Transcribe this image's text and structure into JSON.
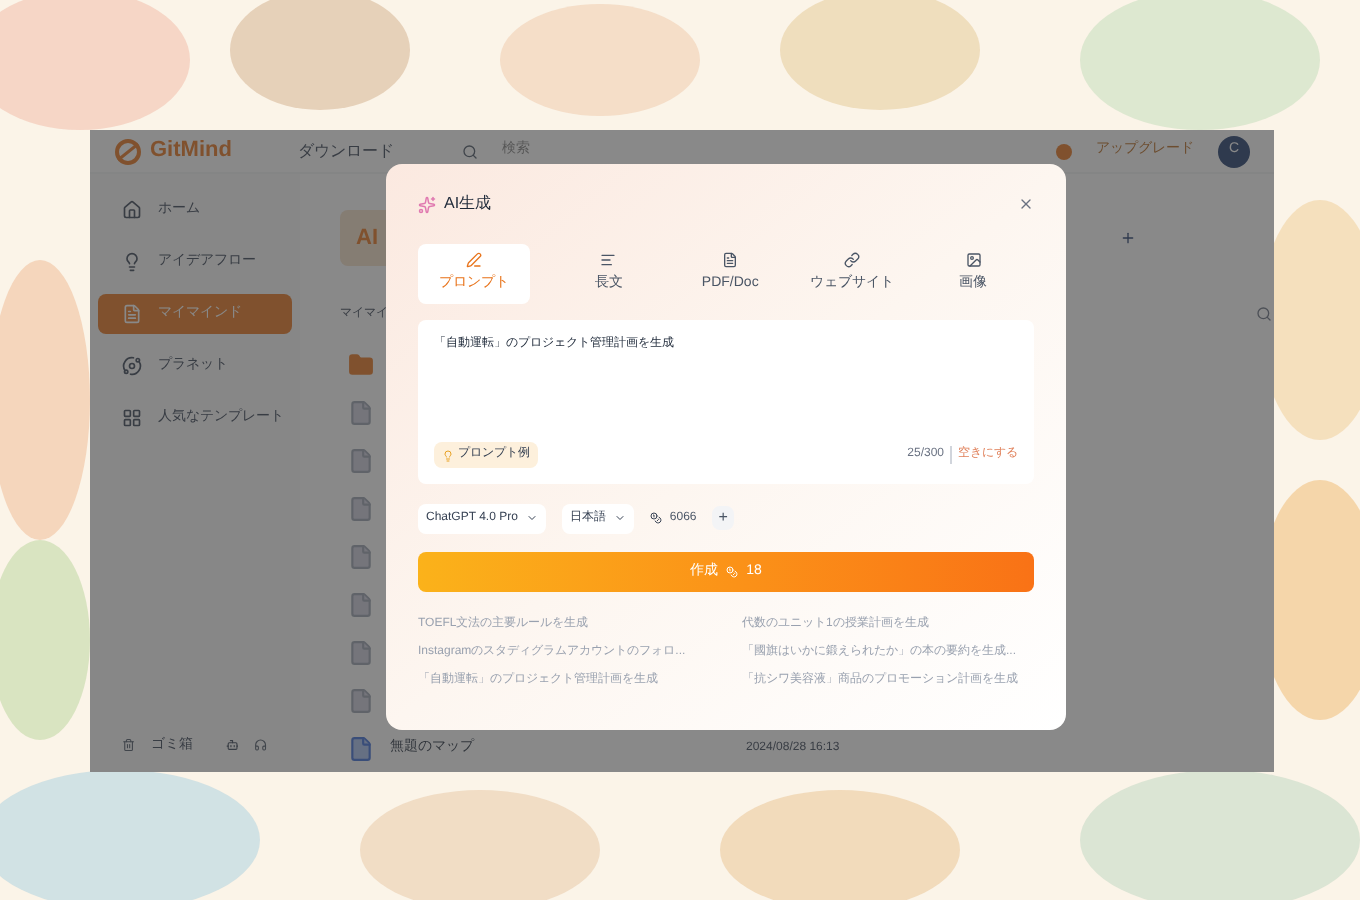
{
  "app": {
    "logo": "GitMind",
    "nav_download": "ダウンロード",
    "search_placeholder": "検索",
    "upgrade": "アップグレード",
    "avatar": "C"
  },
  "sidebar": {
    "items": [
      {
        "kind": "home",
        "label": "ホーム",
        "selected": false
      },
      {
        "kind": "idea",
        "label": "アイデアフロー",
        "selected": false
      },
      {
        "kind": "mind",
        "label": "マイマインド",
        "selected": true
      },
      {
        "kind": "planet",
        "label": "プラネット",
        "selected": false
      },
      {
        "kind": "template",
        "label": "人気なテンプレート",
        "selected": false
      }
    ],
    "trash": "ゴミ箱"
  },
  "content": {
    "ai_card": "AI",
    "section_label": "マイマイ",
    "files": [
      {
        "kind": "folder"
      },
      {
        "kind": "map"
      },
      {
        "kind": "map"
      },
      {
        "kind": "map"
      },
      {
        "kind": "map"
      },
      {
        "kind": "map"
      },
      {
        "kind": "map"
      },
      {
        "kind": "map"
      }
    ],
    "last_file": {
      "name": "無題のマップ",
      "date": "2024/08/28 16:13"
    }
  },
  "dialog": {
    "title": "AI生成",
    "tabs": [
      {
        "kind": "prompt",
        "label": "プロンプト",
        "selected": true
      },
      {
        "kind": "long",
        "label": "長文",
        "selected": false
      },
      {
        "kind": "pdf",
        "label": "PDF/Doc",
        "selected": false
      },
      {
        "kind": "web",
        "label": "ウェブサイト",
        "selected": false
      },
      {
        "kind": "image",
        "label": "画像",
        "selected": false
      }
    ],
    "prompt": "「自動運転」のプロジェクト管理計画を生成",
    "example_button": "プロンプト例",
    "counter": "25/300",
    "clear": "空きにする",
    "model": "ChatGPT 4.0 Pro",
    "language": "日本語",
    "credits": "6066",
    "add": "+",
    "create": "作成",
    "cost": "18",
    "suggestions": [
      "TOEFL文法の主要ルールを生成",
      "代数のユニット1の授業計画を生成",
      "Instagramのスタディグラムアカウントのフォロ...",
      "「國旗はいかに鍛えられたか」の本の要約を生成...",
      "「自動運転」のプロジェクト管理計画を生成",
      "「抗シワ美容液」商品のプロモーション計画を生成"
    ]
  }
}
